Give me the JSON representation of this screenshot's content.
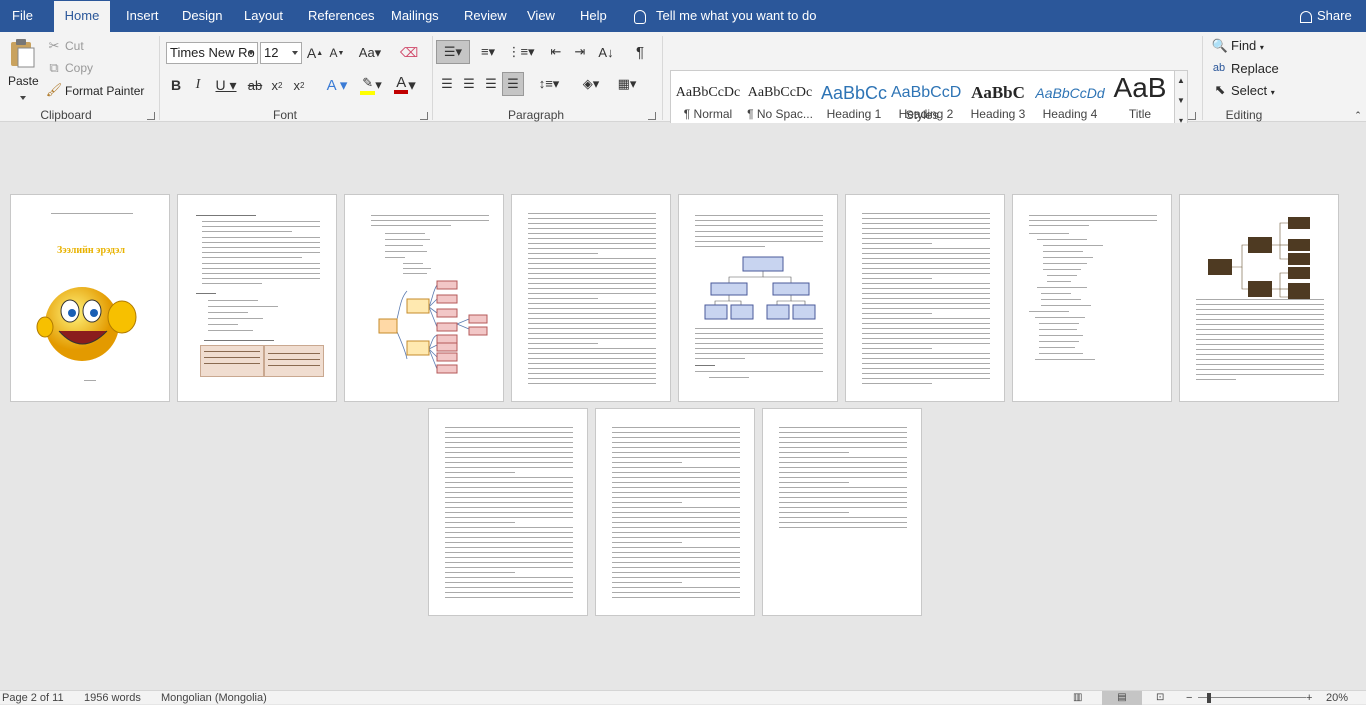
{
  "tabs": [
    "File",
    "Home",
    "Insert",
    "Design",
    "Layout",
    "References",
    "Mailings",
    "Review",
    "View",
    "Help"
  ],
  "tellme": "Tell me what you want to do",
  "share": "Share",
  "clipboard": {
    "paste": "Paste",
    "cut": "Cut",
    "copy": "Copy",
    "format_painter": "Format Painter",
    "label": "Clipboard"
  },
  "font": {
    "name": "Times New Ro",
    "size": "12",
    "label": "Font"
  },
  "paragraph": {
    "label": "Paragraph"
  },
  "styles": {
    "label": "Styles",
    "items": [
      {
        "preview": "AaBbCcDc",
        "name": "¶ Normal"
      },
      {
        "preview": "AaBbCcDc",
        "name": "¶ No Spac..."
      },
      {
        "preview": "AaBbCc",
        "name": "Heading 1"
      },
      {
        "preview": "AaBbCcD",
        "name": "Heading 2"
      },
      {
        "preview": "AaBbC",
        "name": "Heading 3"
      },
      {
        "preview": "AaBbCcDd",
        "name": "Heading 4"
      },
      {
        "preview": "AaB",
        "name": "Title"
      }
    ]
  },
  "editing": {
    "find": "Find",
    "replace": "Replace",
    "select": "Select",
    "label": "Editing"
  },
  "document": {
    "cover_title": "Зээлийн эрэдэл"
  },
  "status": {
    "page": "Page 2 of 11",
    "words": "1956 words",
    "language": "Mongolian (Mongolia)",
    "zoom": "20%"
  },
  "colors": {
    "tabbar": "#2b579a",
    "ribbon": "#f3f3f3",
    "canvas": "#e6e6e6",
    "highlight": "#ffff00",
    "font_color": "#c00000"
  }
}
